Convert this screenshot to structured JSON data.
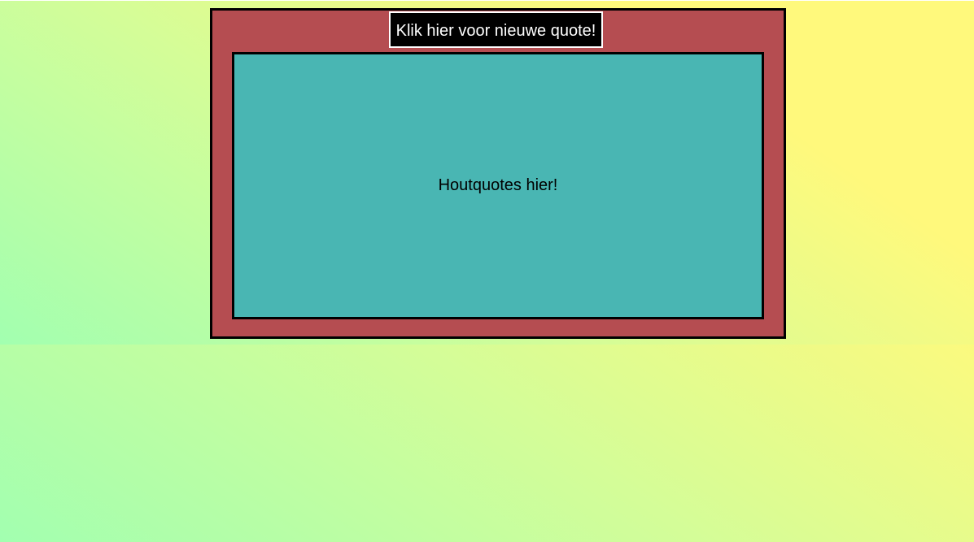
{
  "quote_button": {
    "label": "Klik hier voor nieuwe quote!"
  },
  "quote_panel": {
    "text": "Houtquotes hier!"
  },
  "colors": {
    "frame": "#b54d51",
    "panel": "#49b6b3",
    "button_bg": "#000000",
    "button_text": "#ffffff",
    "gradient_green": "#a2ffb0",
    "gradient_yellow": "#fff97c"
  }
}
